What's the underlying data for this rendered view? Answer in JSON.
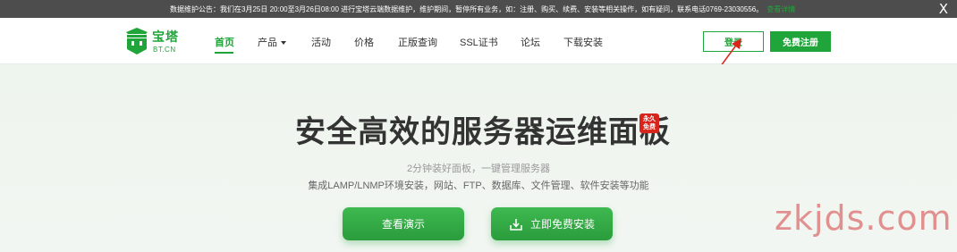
{
  "notice": {
    "text": "数据维护公告：我们在3月25日 20:00至3月26日08:00 进行宝塔云端数据维护，维护期间，暂停所有业务，如：注册、购买、续费、安装等相关操作，如有疑问，联系电话0769-23030556。",
    "link": "查看详情",
    "close": "X"
  },
  "brand": {
    "name": "宝塔",
    "domain": "BT.CN",
    "color": "#20a53a"
  },
  "menu": [
    {
      "label": "首页",
      "active": true
    },
    {
      "label": "产品",
      "active": false,
      "dropdown": true
    },
    {
      "label": "活动",
      "active": false
    },
    {
      "label": "价格",
      "active": false
    },
    {
      "label": "正版查询",
      "active": false
    },
    {
      "label": "SSL证书",
      "active": false
    },
    {
      "label": "论坛",
      "active": false
    },
    {
      "label": "下载安装",
      "active": false
    }
  ],
  "auth": {
    "login": "登录",
    "register": "免费注册"
  },
  "hero": {
    "title": "安全高效的服务器运维面板",
    "seal_line1": "永久",
    "seal_line2": "免费",
    "subtitle1": "2分钟装好面板，一键管理服务器",
    "subtitle2": "集成LAMP/LNMP环境安装，网站、FTP、数据库、文件管理、软件安装等功能",
    "demo_button": "查看演示",
    "install_button": "立即免费安装"
  },
  "watermark": "zkjds.com"
}
